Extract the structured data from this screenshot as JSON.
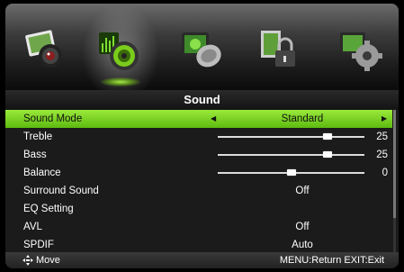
{
  "menu_title": "Sound",
  "tabs": [
    {
      "name": "picture",
      "icon": "picture-icon",
      "active": false
    },
    {
      "name": "sound",
      "icon": "speaker-icon",
      "active": true
    },
    {
      "name": "channel",
      "icon": "satellite-dish-icon",
      "active": false
    },
    {
      "name": "lock",
      "icon": "lock-icon",
      "active": false
    },
    {
      "name": "setup",
      "icon": "gear-icon",
      "active": false
    }
  ],
  "rows": [
    {
      "label": "Sound Mode",
      "value": "Standard",
      "selected": true
    },
    {
      "label": "Treble",
      "slider": 0.75,
      "value": "25"
    },
    {
      "label": "Bass",
      "slider": 0.75,
      "value": "25"
    },
    {
      "label": "Balance",
      "slider": 0.5,
      "value": "0"
    },
    {
      "label": "Surround Sound",
      "value": "Off"
    },
    {
      "label": "EQ Setting",
      "value": ""
    },
    {
      "label": "AVL",
      "value": "Off"
    },
    {
      "label": "SPDIF",
      "value": "Auto"
    }
  ],
  "footer": {
    "move_label": "Move",
    "hints": "MENU:Return  EXIT:Exit"
  },
  "colors": {
    "highlight": "#7fd126",
    "slider": "#dcdcdc"
  }
}
